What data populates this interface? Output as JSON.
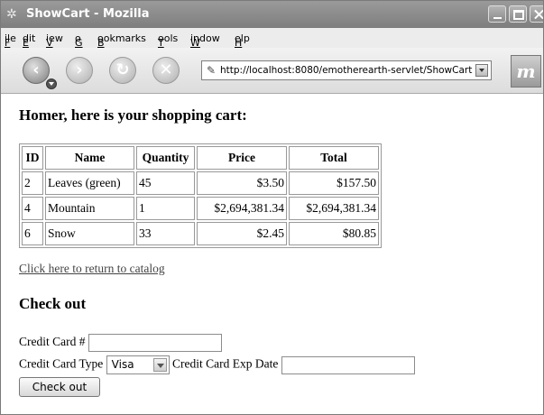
{
  "window": {
    "title": "ShowCart - Mozilla"
  },
  "menu": [
    {
      "label": "File",
      "key": "F"
    },
    {
      "label": "Edit",
      "key": "E"
    },
    {
      "label": "View",
      "key": "V"
    },
    {
      "label": "Go",
      "key": "G"
    },
    {
      "label": "Bookmarks",
      "key": "B"
    },
    {
      "label": "Tools",
      "key": "T"
    },
    {
      "label": "Window",
      "key": "W"
    },
    {
      "label": "Help",
      "key": "H"
    }
  ],
  "nav": {
    "url": "http://localhost:8080/emotherearth-servlet/ShowCart",
    "icons": [
      "back-icon",
      "forward-icon",
      "reload-icon",
      "stop-icon",
      "page-icon",
      "throbber-icon"
    ]
  },
  "page": {
    "heading": "Homer, here is your shopping cart:",
    "table": {
      "headers": [
        "ID",
        "Name",
        "Quantity",
        "Price",
        "Total"
      ],
      "rows": [
        [
          "2",
          "Leaves (green)",
          "45",
          "$3.50",
          "$157.50"
        ],
        [
          "4",
          "Mountain",
          "1",
          "$2,694,381.34",
          "$2,694,381.34"
        ],
        [
          "6",
          "Snow",
          "33",
          "$2.45",
          "$80.85"
        ]
      ]
    },
    "catalog_link": "Click here to return to catalog",
    "checkout_heading": "Check out",
    "cc_number_label": "Credit Card #",
    "cc_type_label": "Credit Card Type",
    "cc_type_value": "Visa",
    "cc_exp_label": "Credit Card Exp Date",
    "checkout_button": "Check out"
  }
}
